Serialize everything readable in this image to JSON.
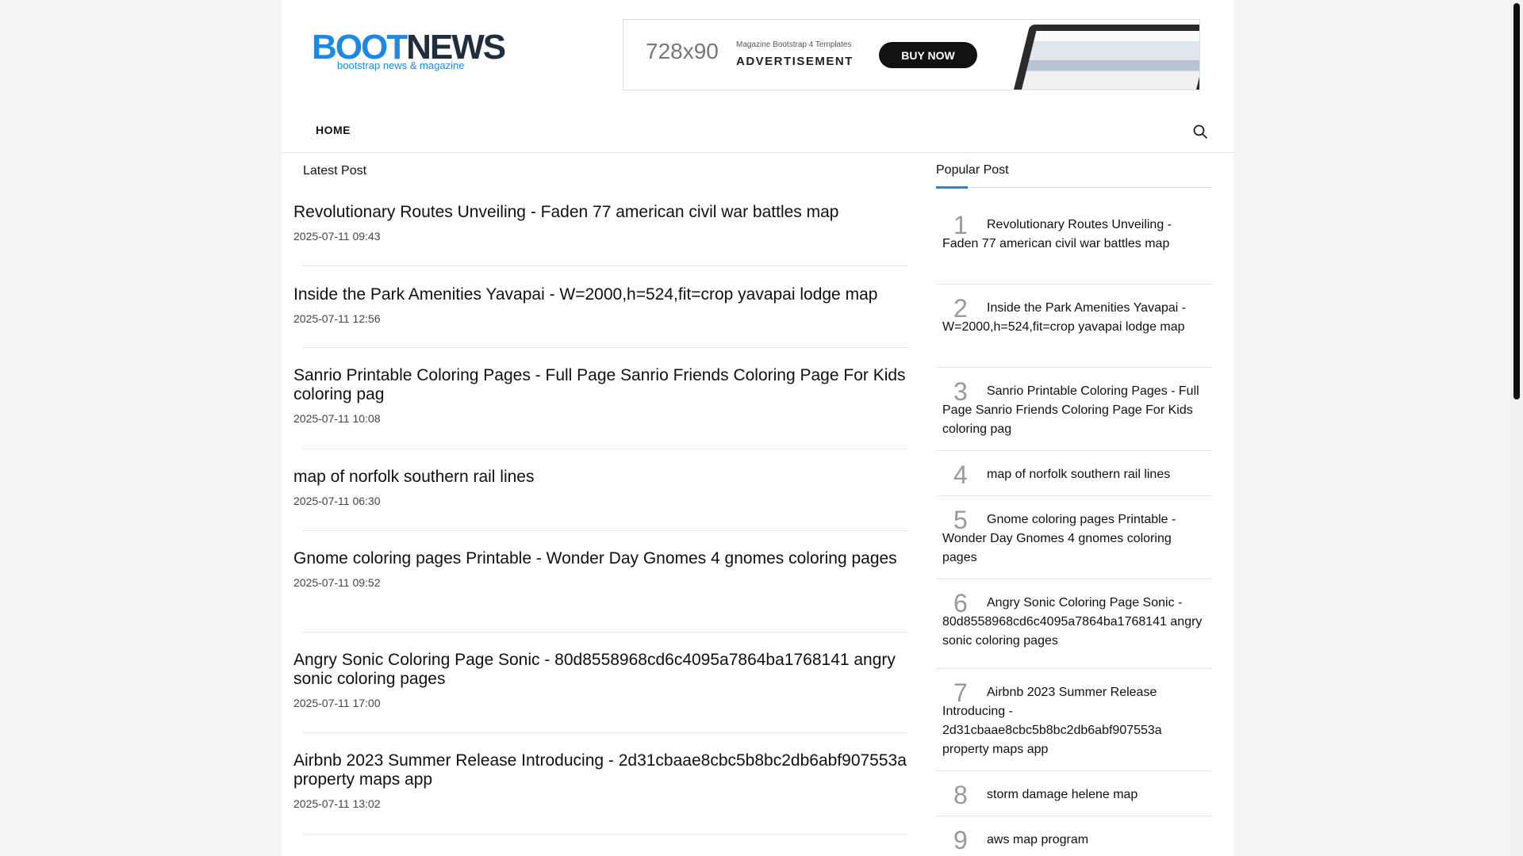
{
  "logo": {
    "part1": "BOOT",
    "part2": "NEWS",
    "tagline": "bootstrap news & magazine"
  },
  "ad": {
    "size": "728x90",
    "small": "Magazine Bootstrap 4 Templates",
    "label": "ADVERTISEMENT",
    "button": "BUY NOW"
  },
  "nav": {
    "home": "HOME",
    "search_icon": "search-icon"
  },
  "latest": {
    "title": "Latest Post",
    "posts": [
      {
        "title": "Revolutionary Routes Unveiling - Faden 77 american civil war battles map",
        "date": "2025-07-11 09:43"
      },
      {
        "title": "Inside the Park Amenities Yavapai - W=2000,h=524,fit=crop yavapai lodge map",
        "date": "2025-07-11 12:56"
      },
      {
        "title": "Sanrio Printable Coloring Pages - Full Page Sanrio Friends Coloring Page For Kids coloring pag",
        "date": "2025-07-11 10:08"
      },
      {
        "title": "map of norfolk southern rail lines",
        "date": "2025-07-11 06:30"
      },
      {
        "title": "Gnome coloring pages Printable - Wonder Day Gnomes 4 gnomes coloring pages",
        "date": "2025-07-11 09:52"
      },
      {
        "title": "Angry Sonic Coloring Page Sonic - 80d8558968cd6c4095a7864ba1768141 angry sonic coloring pages",
        "date": "2025-07-11 17:00"
      },
      {
        "title": "Airbnb 2023 Summer Release Introducing - 2d31cbaae8cbc5b8bc2db6abf907553a property maps app",
        "date": "2025-07-11 13:02"
      }
    ]
  },
  "popular": {
    "title": "Popular Post",
    "items": [
      {
        "num": "1",
        "text": "Revolutionary Routes Unveiling - Faden 77 american civil war battles map"
      },
      {
        "num": "2",
        "text": "Inside the Park Amenities Yavapai - W=2000,h=524,fit=crop yavapai lodge map"
      },
      {
        "num": "3",
        "text": "Sanrio Printable Coloring Pages - Full Page Sanrio Friends Coloring Page For Kids coloring pag"
      },
      {
        "num": "4",
        "text": "map of norfolk southern rail lines"
      },
      {
        "num": "5",
        "text": "Gnome coloring pages Printable - Wonder Day Gnomes 4 gnomes coloring pages"
      },
      {
        "num": "6",
        "text": "Angry Sonic Coloring Page Sonic - 80d8558968cd6c4095a7864ba1768141 angry sonic coloring pages"
      },
      {
        "num": "7",
        "text": "Airbnb 2023 Summer Release Introducing - 2d31cbaae8cbc5b8bc2db6abf907553a property maps app"
      },
      {
        "num": "8",
        "text": "storm damage helene map"
      },
      {
        "num": "9",
        "text": "aws map program"
      }
    ]
  },
  "colors": {
    "accent": "#1e88e5",
    "logo_dark": "#1f2d3d"
  }
}
